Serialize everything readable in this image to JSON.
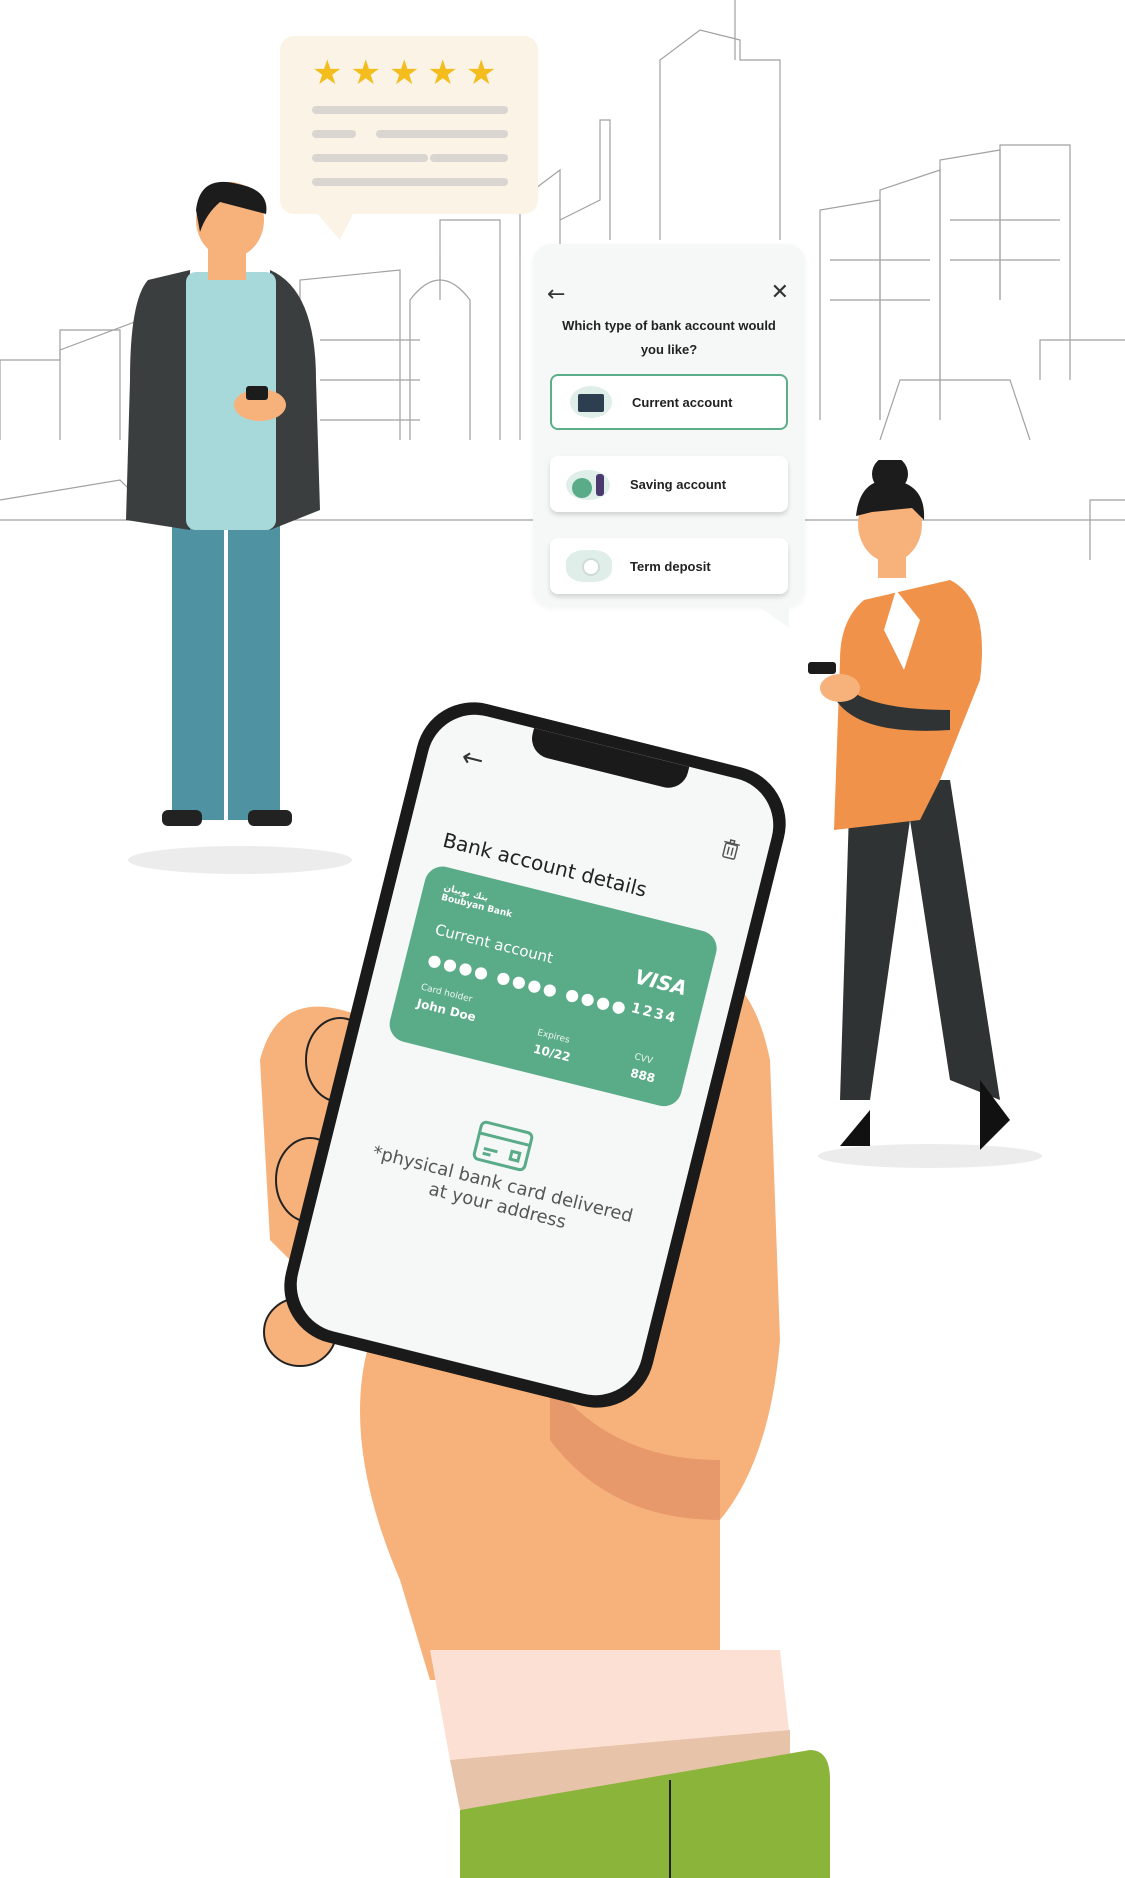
{
  "review": {
    "rating": 5,
    "max_rating": 5
  },
  "dialog": {
    "question": "Which type of bank account would you like?",
    "options": [
      {
        "label": "Current account",
        "selected": true
      },
      {
        "label": "Saving account",
        "selected": false
      },
      {
        "label": "Term deposit",
        "selected": false
      }
    ]
  },
  "phone": {
    "title": "Bank account details",
    "card": {
      "bank_name_ar": "بنك بوبيان",
      "bank_name": "Boubyan Bank",
      "account_type": "Current account",
      "brand": "VISA",
      "masked_number": "●●●● ●●●● ●●●●",
      "last4": "1234",
      "holder_label": "Card holder",
      "holder": "John Doe",
      "expires_label": "Expires",
      "expires": "10/22",
      "cvv_label": "CVV",
      "cvv": "888"
    },
    "note": "*physical bank card delivered at your address"
  },
  "colors": {
    "accent": "#5aab88",
    "star": "#f2bd1d",
    "jacket": "#f0924a",
    "sleeve": "#8bb43a",
    "skin": "#f7b27c"
  }
}
